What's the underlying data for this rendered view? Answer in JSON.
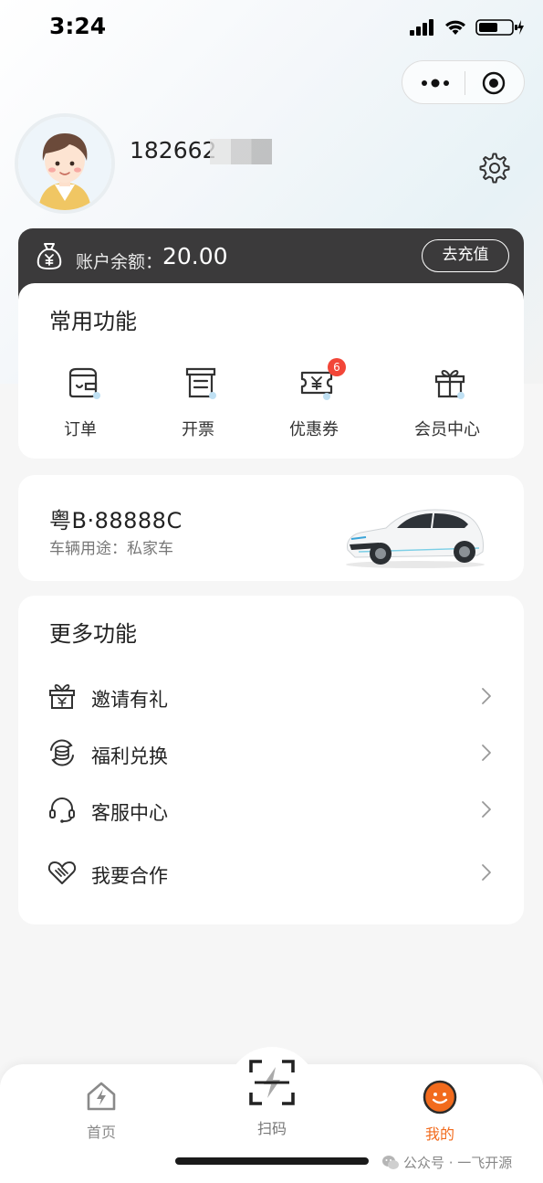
{
  "status_bar": {
    "time": "3:24"
  },
  "profile": {
    "phone": "182662",
    "phone_masked": true
  },
  "balance": {
    "label": "账户余额：",
    "value": "20.00",
    "recharge_label": "去充值"
  },
  "common_functions": {
    "title": "常用功能",
    "items": [
      {
        "label": "订单",
        "icon": "wallet-order-icon"
      },
      {
        "label": "开票",
        "icon": "invoice-icon"
      },
      {
        "label": "优惠券",
        "icon": "coupon-icon",
        "badge": "6"
      },
      {
        "label": "会员中心",
        "icon": "gift-box-icon"
      }
    ]
  },
  "vehicle": {
    "plate": "粤B·88888C",
    "usage": "车辆用途：私家车"
  },
  "more_functions": {
    "title": "更多功能",
    "items": [
      {
        "label": "邀请有礼",
        "icon": "gift-icon"
      },
      {
        "label": "福利兑换",
        "icon": "coin-exchange-icon"
      },
      {
        "label": "客服中心",
        "icon": "headset-icon"
      },
      {
        "label": "我要合作",
        "icon": "handshake-heart-icon"
      }
    ]
  },
  "tab_bar": {
    "home": "首页",
    "scan": "扫码",
    "mine": "我的",
    "active": "mine"
  },
  "watermark": "公众号 · 一飞开源",
  "colors": {
    "accent": "#f26b1d",
    "dark_card": "#3b3a3b",
    "badge": "#f24638",
    "icon_dot": "#bfe0f3"
  }
}
